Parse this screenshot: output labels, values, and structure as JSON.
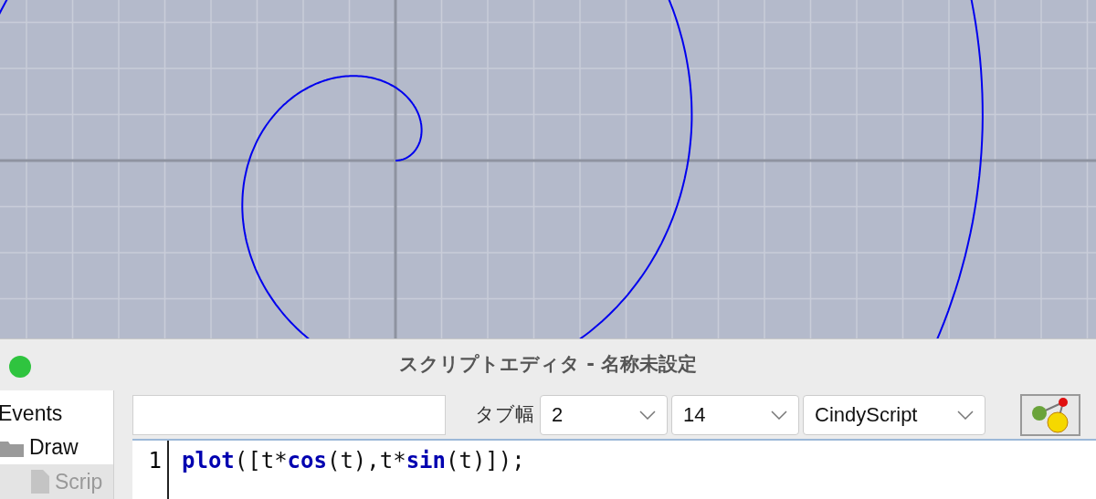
{
  "window": {
    "title": "スクリプトエディタ - 名称未設定"
  },
  "sidebar": {
    "items": [
      {
        "label": "Events",
        "kind": "plain",
        "selected": false,
        "children": [
          {
            "label": "Draw",
            "kind": "folder",
            "selected": false,
            "children": [
              {
                "label": "Scrip",
                "kind": "file",
                "selected": true
              }
            ]
          }
        ]
      }
    ]
  },
  "toolbar": {
    "tab_width_label": "タブ幅",
    "dropdowns": [
      {
        "value": "2"
      },
      {
        "value": "14"
      },
      {
        "value": "CindyScript"
      }
    ]
  },
  "editor": {
    "lines": [
      {
        "number": "1",
        "tokens": [
          {
            "text": "plot",
            "kind": "keyword"
          },
          {
            "text": "([t*",
            "kind": "plain"
          },
          {
            "text": "cos",
            "kind": "keyword"
          },
          {
            "text": "(t),t*",
            "kind": "plain"
          },
          {
            "text": "sin",
            "kind": "keyword"
          },
          {
            "text": "(t)]);",
            "kind": "plain"
          }
        ]
      }
    ]
  }
}
